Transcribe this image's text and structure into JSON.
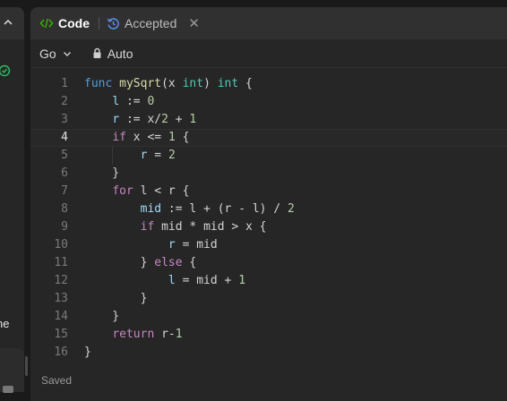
{
  "left_panel": {
    "partial_text": "ne"
  },
  "tabs": [
    {
      "label": "Code",
      "icon": "code-icon",
      "color": "#38b000"
    },
    {
      "label": "Accepted",
      "icon": "history-icon"
    }
  ],
  "toolbar": {
    "language": "Go",
    "mode": "Auto"
  },
  "editor": {
    "current_line": 4,
    "line_numbers": [
      "1",
      "2",
      "3",
      "4",
      "5",
      "6",
      "7",
      "8",
      "9",
      "10",
      "11",
      "12",
      "13",
      "14",
      "15",
      "16"
    ]
  },
  "status": {
    "text": "Saved"
  },
  "colors": {
    "background": "#262626",
    "tab_bar": "#303030",
    "keyword": "#c586c0",
    "function": "#dcdcaa",
    "type": "#4ec9b0",
    "number": "#b5cea8"
  }
}
